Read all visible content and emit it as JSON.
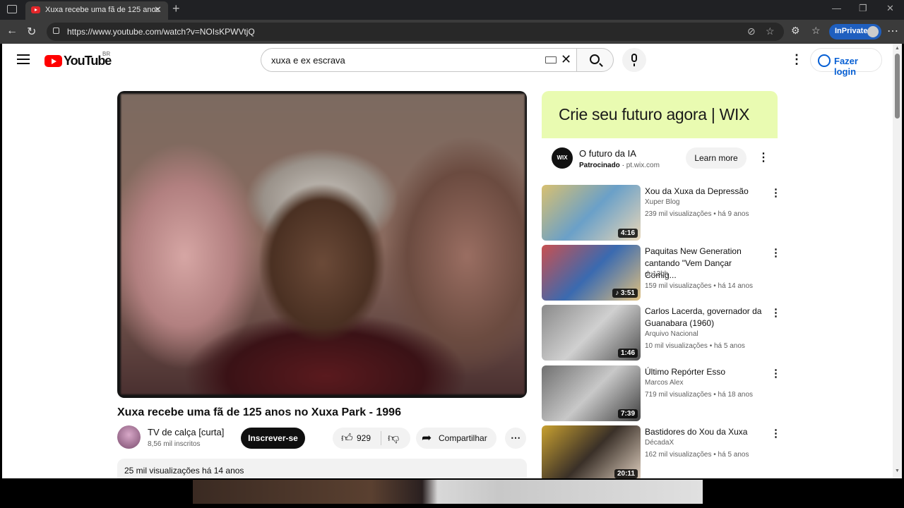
{
  "browser": {
    "tab_title": "Xuxa recebe uma fã de 125 anos",
    "url": "https://www.youtube.com/watch?v=NOIsKPWVtjQ",
    "inprivate_label": "InPrivate"
  },
  "header": {
    "logo_text": "YouTube",
    "country_code": "BR",
    "search_value": "xuxa e ex escrava",
    "login_label": "Fazer login"
  },
  "video": {
    "title": "Xuxa recebe uma fã de 125 anos no Xuxa Park - 1996",
    "channel_name": "TV de calça [curta]",
    "subscribers": "8,56 mil inscritos",
    "subscribe_label": "Inscrever-se",
    "likes": "929",
    "share_label": "Compartilhar",
    "views_date": "25 mil visualizações  há 14 anos"
  },
  "ad": {
    "banner_text": "Crie seu futuro agora | WIX",
    "logo_text": "WIX",
    "title": "O futuro da IA",
    "sponsored_label": "Patrocinado",
    "domain": "pt.wix.com",
    "cta_label": "Learn more"
  },
  "recommendations": [
    {
      "title": "Xou da Xuxa da Depressão",
      "channel": "Xuper Blog",
      "meta": "239 mil visualizações • há 9 anos",
      "duration": "4:16",
      "thumb_colors": [
        "#d8c070",
        "#6aa0c8",
        "#e8d6b8"
      ]
    },
    {
      "title": "Paquitas New Generation cantando \"Vem Dançar Comig...",
      "channel": "du13bh",
      "meta": "159 mil visualizações • há 14 anos",
      "duration": "♪ 3:51",
      "thumb_colors": [
        "#c85050",
        "#3a6ab0",
        "#e0c080"
      ]
    },
    {
      "title": "Carlos Lacerda, governador da Guanabara (1960)",
      "channel": "Arquivo Nacional",
      "meta": "10 mil visualizações • há 5 anos",
      "duration": "1:46",
      "thumb_colors": [
        "#8a8a8a",
        "#d0d0d0",
        "#505050"
      ]
    },
    {
      "title": "Último Repórter Esso",
      "channel": "Marcos Alex",
      "meta": "719 mil visualizações • há 18 anos",
      "duration": "7:39",
      "thumb_colors": [
        "#707070",
        "#c8c8c8",
        "#404040"
      ]
    },
    {
      "title": "Bastidores do Xou da Xuxa",
      "channel": "DécadaX",
      "meta": "162 mil visualizações • há 5 anos",
      "duration": "20:11",
      "thumb_colors": [
        "#c8a030",
        "#3a3028",
        "#e0d0c0"
      ]
    }
  ]
}
